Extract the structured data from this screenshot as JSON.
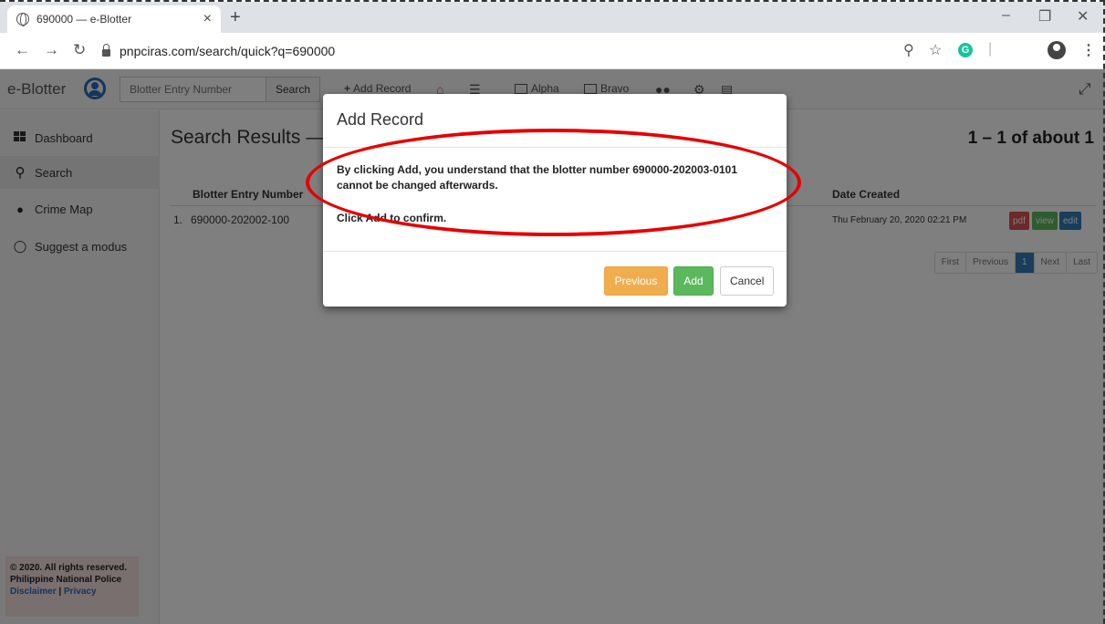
{
  "browser": {
    "tab_title": "690000 — e-Blotter",
    "tab_close": "×",
    "new_tab": "+",
    "url": "pnpciras.com/search/quick?q=690000",
    "grammarly": "G"
  },
  "navbar": {
    "brand": "e-Blotter",
    "search_placeholder": "Blotter Entry Number",
    "search_button": "Search",
    "add_record": "Add Record",
    "alpha": "Alpha",
    "bravo": "Bravo"
  },
  "sidebar": {
    "items": [
      {
        "label": "Dashboard",
        "icon": "grid-icon"
      },
      {
        "label": "Search",
        "icon": "search-icon"
      },
      {
        "label": "Crime Map",
        "icon": "map-marker-icon"
      },
      {
        "label": "Suggest a modus",
        "icon": "lightbulb-icon"
      }
    ],
    "footer": {
      "copyright": "© 2020. All rights reserved.",
      "org": "Philippine National Police",
      "disclaimer": "Disclaimer",
      "separator": " | ",
      "privacy": "Privacy"
    }
  },
  "main": {
    "title": "Search Results —",
    "count": "1 – 1 of about 1",
    "columns": {
      "entry": "Blotter Entry Number",
      "date": "Date Created"
    },
    "rows": [
      {
        "index": "1.",
        "entry": "690000-202002-100",
        "date": "Thu February 20, 2020 02:21 PM"
      }
    ],
    "row_actions": {
      "pdf": "pdf",
      "view": "view",
      "edit": "edit"
    },
    "pager": {
      "first": "First",
      "previous": "Previous",
      "current": "1",
      "next": "Next",
      "last": "Last"
    }
  },
  "modal": {
    "title": "Add Record",
    "message": "By clicking Add, you understand that the blotter number 690000-202003-0101 cannot be changed afterwards.",
    "confirm": "Click Add to confirm.",
    "buttons": {
      "previous": "Previous",
      "add": "Add",
      "cancel": "Cancel"
    }
  },
  "colors": {
    "annotation": "#e60000",
    "primary": "#337ab7",
    "success": "#5cb85c",
    "warning": "#f0ad4e",
    "danger": "#d9534f"
  }
}
